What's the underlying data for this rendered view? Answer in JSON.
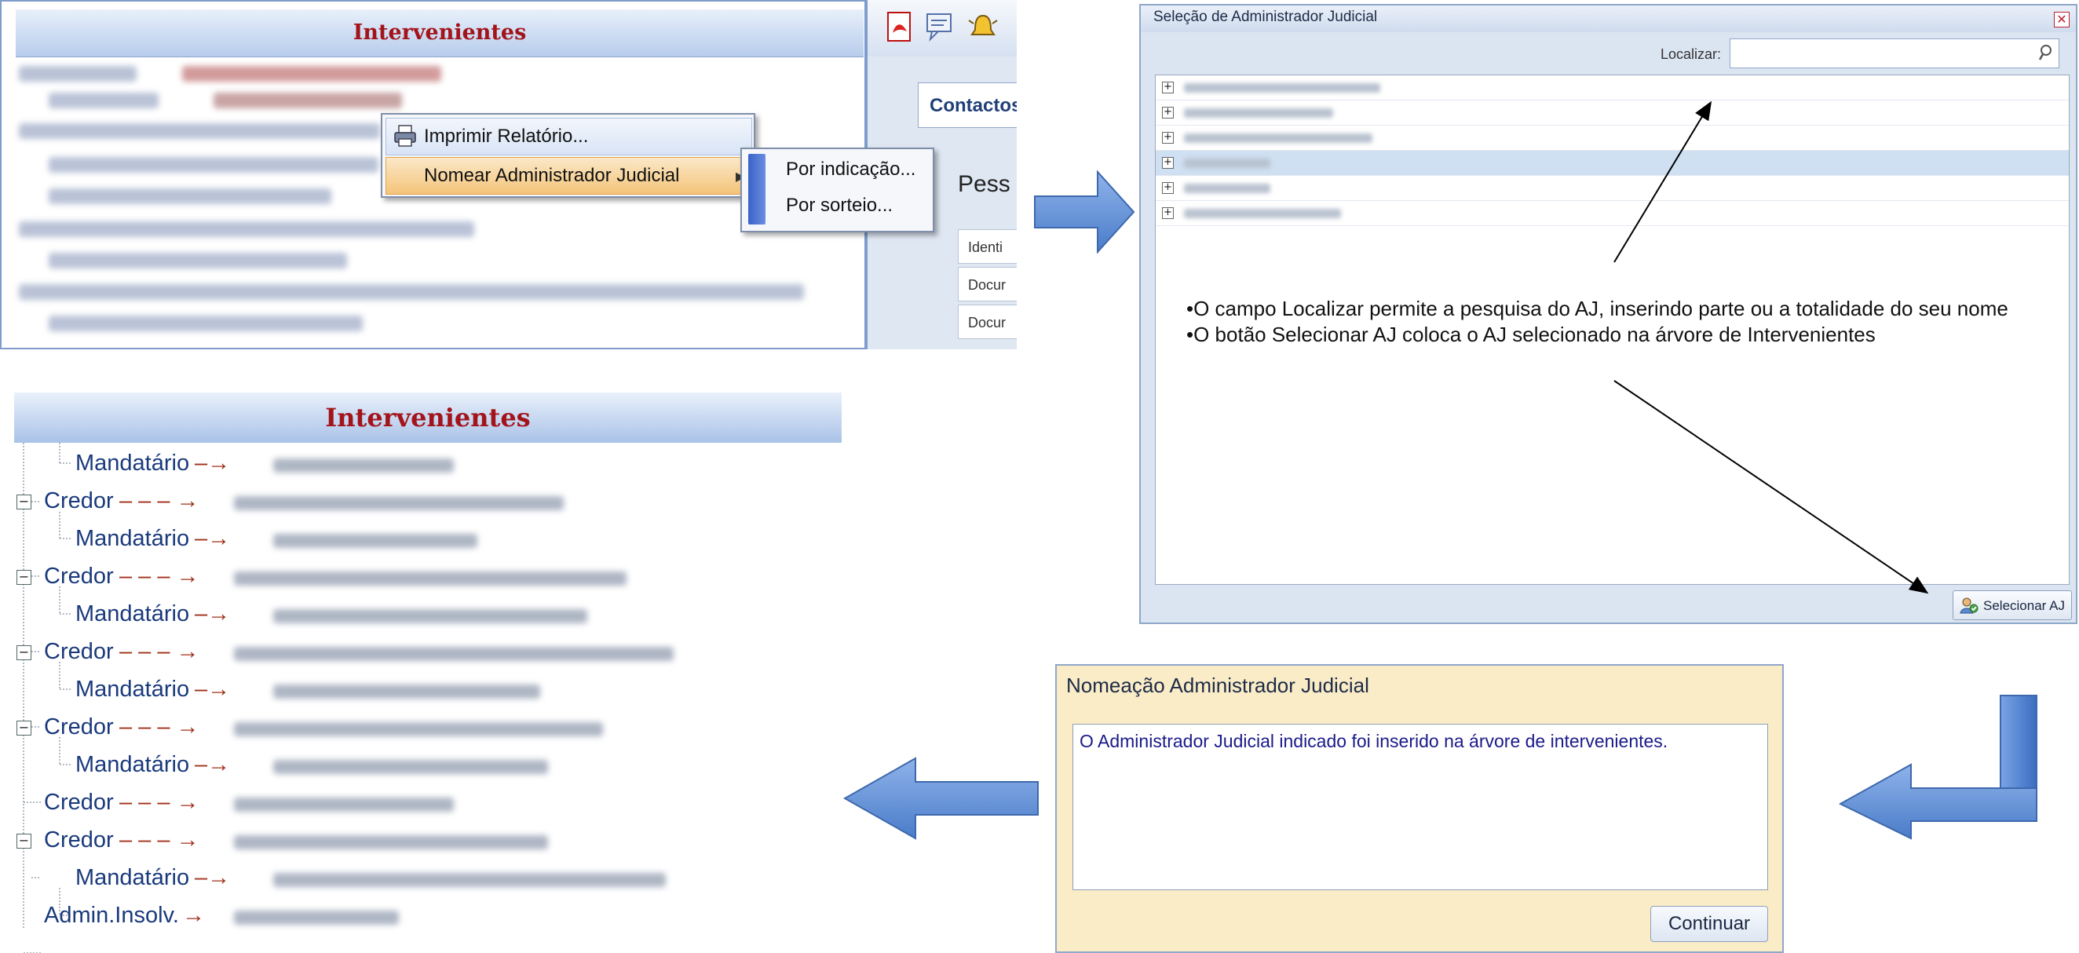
{
  "panel1": {
    "tree_title": "Intervenientes",
    "context_menu": {
      "print_report": "Imprimir Relatório...",
      "appoint_admin": "Nomear Administrador Judicial"
    },
    "submenu": {
      "by_indication": "Por indicação...",
      "by_draw": "Por sorteio..."
    },
    "side": {
      "contacts_tab": "Contactos",
      "pessoa_label": "Pess",
      "fields": [
        "Identi",
        "Docur",
        "Docur"
      ]
    }
  },
  "panel2": {
    "window_title": "Seleção de Administrador Judicial",
    "close_glyph": "✕",
    "search_label": "Localizar:",
    "search_value": "",
    "note_lines": [
      "•O campo Localizar permite a pesquisa do AJ, inserindo parte ou a totalidade do seu nome",
      "•O botão Selecionar AJ coloca o AJ selecionado na árvore de Intervenientes"
    ],
    "select_button": "Selecionar AJ"
  },
  "panel3": {
    "tree_title": "Intervenientes",
    "rows": [
      {
        "label": "Mandatário",
        "arrow": "–→"
      },
      {
        "label": "Credor",
        "arrow": "– – – →"
      },
      {
        "label": "Mandatário",
        "arrow": "–→"
      },
      {
        "label": "Credor",
        "arrow": "– – – →"
      },
      {
        "label": "Mandatário",
        "arrow": "–→"
      },
      {
        "label": "Credor",
        "arrow": "– – – →"
      },
      {
        "label": "Mandatário",
        "arrow": "–→"
      },
      {
        "label": "Credor",
        "arrow": "– – – →"
      },
      {
        "label": "Mandatário",
        "arrow": "–→"
      },
      {
        "label": "Credor",
        "arrow": "– – – →"
      },
      {
        "label": "Credor",
        "arrow": "– – – →"
      },
      {
        "label": "Mandatário",
        "arrow": "–→"
      },
      {
        "label": "Admin.Insolv.",
        "arrow": "→"
      }
    ]
  },
  "panel4": {
    "title": "Nomeação Administrador Judicial",
    "message": "O Administrador Judicial indicado foi inserido na árvore de intervenientes.",
    "continue_button": "Continuar"
  },
  "colors": {
    "tree_title": "#a3141a",
    "tree_text": "#1a3a7c",
    "flow_arrow": "#5d8fd6",
    "menu_highlight": "#f4c479",
    "dialog_bg": "#fbecc8"
  }
}
